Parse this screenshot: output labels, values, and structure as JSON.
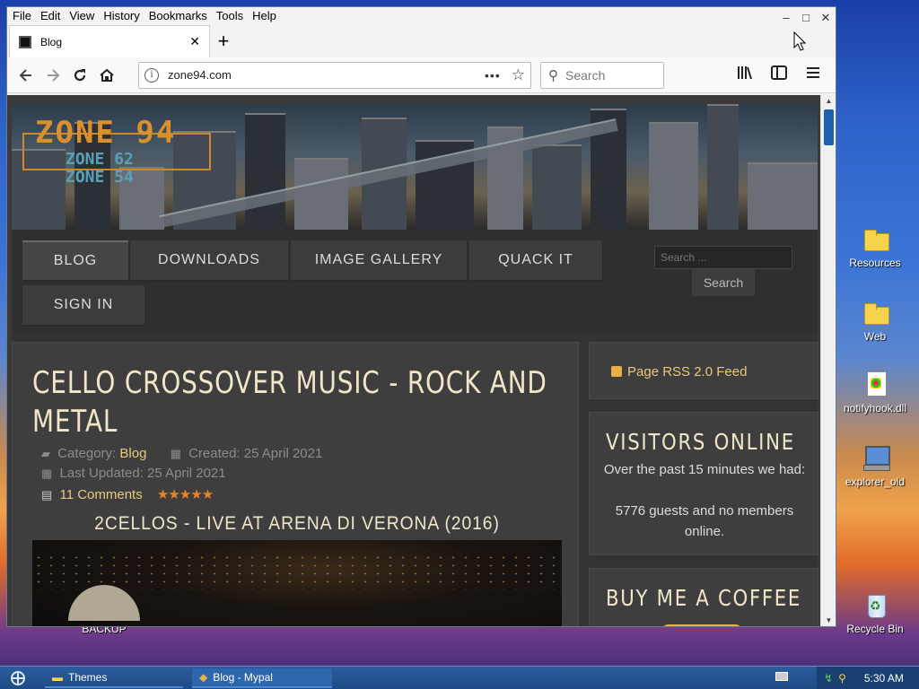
{
  "desktop": {
    "icons": [
      {
        "label": "Resources",
        "type": "folder"
      },
      {
        "label": "Web",
        "type": "folder"
      },
      {
        "label": "notifyhook.dll",
        "type": "dll"
      },
      {
        "label": "explorer_old",
        "type": "exe"
      },
      {
        "label": "Recycle Bin",
        "type": "bin"
      }
    ],
    "hidden_label": "BACKUP"
  },
  "browser": {
    "menu": [
      "File",
      "Edit",
      "View",
      "History",
      "Bookmarks",
      "Tools",
      "Help"
    ],
    "window_controls": {
      "minimize": "–",
      "maximize": "□",
      "close": "✕"
    },
    "tab": {
      "title": "Blog",
      "close": "✕"
    },
    "new_tab": "+",
    "url": "zone94.com",
    "url_more": "•••",
    "search_placeholder": "Search",
    "icons": {
      "back": "back-icon",
      "forward": "forward-icon",
      "reload": "reload-icon",
      "home": "home-icon",
      "library": "library-icon",
      "sidebar": "sidebar-icon",
      "menu": "hamburger-menu-icon"
    }
  },
  "site": {
    "logo": "ZONE 94",
    "logo_sub": [
      "ZONE 62",
      "ZONE 54"
    ],
    "nav": [
      "BLOG",
      "DOWNLOADS",
      "IMAGE GALLERY",
      "QUACK IT",
      "SIGN IN"
    ],
    "search_placeholder": "Search ...",
    "search_button": "Search",
    "article": {
      "title": "CELLO CROSSOVER MUSIC - ROCK AND METAL",
      "category_label": "Category:",
      "category": "Blog",
      "created": "Created: 25 April 2021",
      "updated": "Last Updated: 25 April 2021",
      "comments": "11 Comments",
      "stars": "★★★★★",
      "subtitle": "2CELLOS - LIVE AT ARENA DI VERONA (2016)"
    },
    "sidebar": {
      "rss": "Page RSS 2.0 Feed",
      "visitors_title": "VISITORS ONLINE",
      "visitors_text1": "Over the past 15 minutes we had:",
      "visitors_text2": "5776 guests and no members online.",
      "coffee_title": "BUY ME A COFFEE"
    }
  },
  "taskbar": {
    "tasks": [
      "Themes",
      "Blog - Mypal"
    ],
    "clock": "5:30 AM"
  },
  "colors": {
    "accent": "#e9c97c",
    "title": "#f1e6c8",
    "taskbar": "#1e4b85",
    "stars": "#e8832a"
  }
}
